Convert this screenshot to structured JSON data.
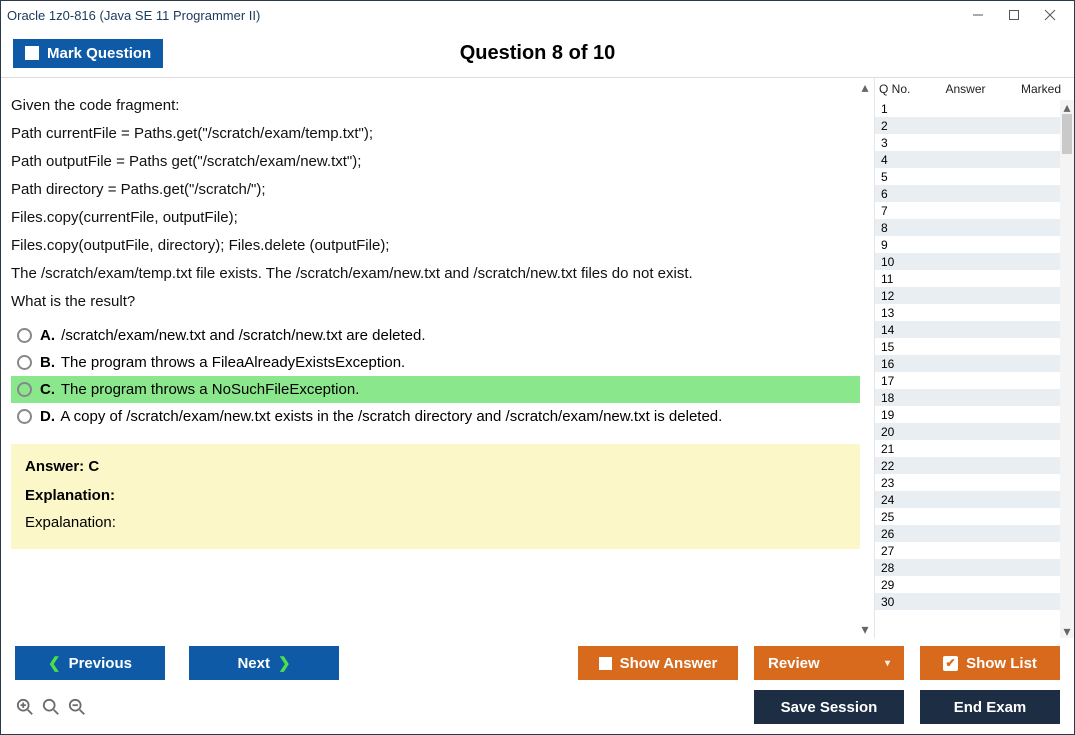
{
  "window": {
    "title": "Oracle 1z0-816 (Java SE 11 Programmer II)"
  },
  "topbar": {
    "mark_label": "Mark Question",
    "question_counter": "Question 8 of 10"
  },
  "question": {
    "lines": [
      "Given the code fragment:",
      "Path currentFile = Paths.get(\"/scratch/exam/temp.txt\");",
      "Path outputFile = Paths get(\"/scratch/exam/new.txt\");",
      "Path directory = Paths.get(\"/scratch/\");",
      "Files.copy(currentFile, outputFile);",
      "Files.copy(outputFile, directory); Files.delete (outputFile);",
      "The /scratch/exam/temp.txt file exists. The /scratch/exam/new.txt and /scratch/new.txt files do not exist.",
      "What is the result?"
    ],
    "options": [
      {
        "letter": "A.",
        "text": "/scratch/exam/new.txt and /scratch/new.txt are deleted.",
        "correct": false
      },
      {
        "letter": "B.",
        "text": "The program throws a FileaAlreadyExistsException.",
        "correct": false
      },
      {
        "letter": "C.",
        "text": "The program throws a NoSuchFileException.",
        "correct": true
      },
      {
        "letter": "D.",
        "text": "A copy of /scratch/exam/new.txt exists in the /scratch directory and /scratch/exam/new.txt is deleted.",
        "correct": false
      }
    ]
  },
  "answer_box": {
    "answer_label": "Answer: C",
    "explanation_head": "Explanation:",
    "explanation_body": "Expalanation:"
  },
  "grid": {
    "headers": {
      "qno": "Q No.",
      "answer": "Answer",
      "marked": "Marked"
    },
    "rows": [
      {
        "no": "1"
      },
      {
        "no": "2"
      },
      {
        "no": "3"
      },
      {
        "no": "4"
      },
      {
        "no": "5"
      },
      {
        "no": "6"
      },
      {
        "no": "7"
      },
      {
        "no": "8"
      },
      {
        "no": "9"
      },
      {
        "no": "10"
      },
      {
        "no": "11"
      },
      {
        "no": "12"
      },
      {
        "no": "13"
      },
      {
        "no": "14"
      },
      {
        "no": "15"
      },
      {
        "no": "16"
      },
      {
        "no": "17"
      },
      {
        "no": "18"
      },
      {
        "no": "19"
      },
      {
        "no": "20"
      },
      {
        "no": "21"
      },
      {
        "no": "22"
      },
      {
        "no": "23"
      },
      {
        "no": "24"
      },
      {
        "no": "25"
      },
      {
        "no": "26"
      },
      {
        "no": "27"
      },
      {
        "no": "28"
      },
      {
        "no": "29"
      },
      {
        "no": "30"
      }
    ]
  },
  "footer": {
    "previous": "Previous",
    "next": "Next",
    "show_answer": "Show Answer",
    "review": "Review",
    "show_list": "Show List",
    "save_session": "Save Session",
    "end_exam": "End Exam"
  }
}
